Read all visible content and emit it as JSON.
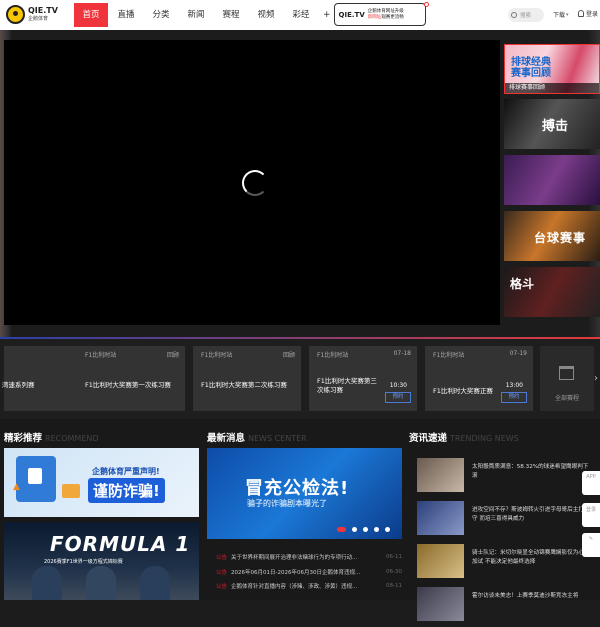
{
  "logo": {
    "name": "QIE.TV",
    "sub": "企鹅体育"
  },
  "nav": [
    "首页",
    "直播",
    "分类",
    "新闻",
    "赛程",
    "视频",
    "彩经"
  ],
  "promo": {
    "plus": "+",
    "brand": "QIE.TV",
    "line1": "企鹅体育网址升级",
    "line2_hl": "新网址",
    "line2": "观赛更流畅"
  },
  "search_placeholder": "搜索",
  "download": "下载",
  "login": "登录",
  "side_thumbs": [
    {
      "big": "排球经典\n赛事回顾",
      "label": "排球赛事回顾"
    },
    {
      "big": "搏击",
      "label": ""
    },
    {
      "big": "",
      "label": ""
    },
    {
      "big": "台球赛事",
      "label": ""
    },
    {
      "big": "格斗",
      "label": ""
    }
  ],
  "schedule": [
    {
      "tag": "",
      "status": "回顾",
      "title": "湾速系列赛",
      "time": "",
      "action": ""
    },
    {
      "tag": "F1比利时站",
      "status": "回顾",
      "title": "F1比利时大奖赛第一次练习赛",
      "time": "",
      "action": ""
    },
    {
      "tag": "F1比利时站",
      "status": "回顾",
      "title": "F1比利时大奖赛第二次练习赛",
      "time": "",
      "action": ""
    },
    {
      "tag": "F1比利时站",
      "status": "07-18",
      "title": "F1比利时大奖赛第三次练习赛",
      "time": "10:30",
      "action": "预约"
    },
    {
      "tag": "F1比利时站",
      "status": "07-19",
      "title": "F1比利时大奖赛正赛",
      "time": "13:00",
      "action": "预约"
    }
  ],
  "all_schedule": "全部赛程",
  "sections": {
    "rec": {
      "title": "精彩推荐",
      "en": "RECOMMEND"
    },
    "news": {
      "title": "最新消息",
      "en": "NEWS CENTER"
    },
    "trend": {
      "title": "资讯速递",
      "en": "TRENDING NEWS"
    }
  },
  "rec_banner": {
    "top": "企鹅体育严重声明!",
    "main": "谨防诈骗!"
  },
  "rec_banner2": {
    "main": "FORMULA 1",
    "sub": "2026赛季F1世界一级方程式锦标赛"
  },
  "news_banner": {
    "h1": "冒充公检法!",
    "h2": "骗子的诈骗剧本曝光了"
  },
  "news_list": [
    {
      "k": "公告",
      "t": "关于世界杯期间展开治理非法赌球行为的专项行动...",
      "d": "06-11"
    },
    {
      "k": "公告",
      "t": "2026年06月01日-2026年06月30日企鹅体育违规...",
      "d": "06-30"
    },
    {
      "k": "公告",
      "t": "企鹅体育针对直播内容（涉赌、涉政、涉黄）违规...",
      "d": "08-11"
    }
  ],
  "trending": [
    {
      "t": "太阳骰筒质满意：58.32%的球迷希望鹰眼判下滚",
      "c": "#6a5a4e"
    },
    {
      "t": "进攻空间不存？斯波姆转火引进字母哥后主打防守 而培三喜得具威力",
      "c": "#2b3f7a"
    },
    {
      "t": "骑士队记：米切尔晓显全动锦赛鹰娴影仅为心理加试 不能决定他最终选择",
      "c": "#8a6a2a"
    },
    {
      "t": "霍尔访谈未美志！上赛季莫迪沙斯竞冻主将",
      "c": "#3a3a4a"
    }
  ],
  "float_buttons": [
    "APP",
    "登录",
    ""
  ]
}
